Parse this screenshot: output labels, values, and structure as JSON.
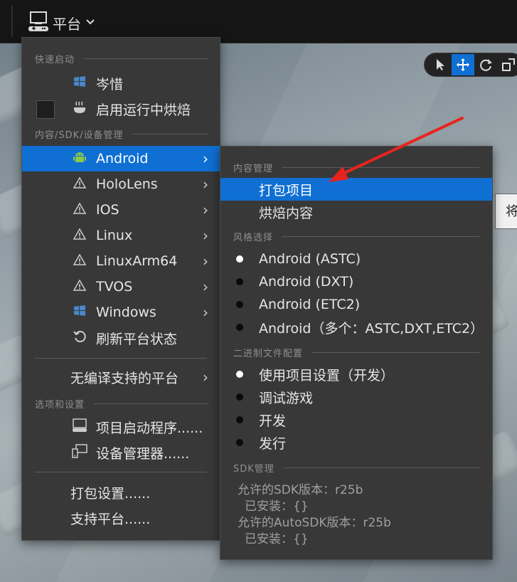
{
  "toolbar": {
    "platforms_label": "平台",
    "icons": {
      "platforms": "gamepad-monitor-icon",
      "dropdown": "chevron-down-icon"
    }
  },
  "gizmo": {
    "buttons": [
      "select-arrow-icon",
      "move-icon",
      "rotate-icon",
      "scale-icon"
    ],
    "active": "move-icon"
  },
  "side_button": {
    "label": "将"
  },
  "menu": {
    "sections": {
      "quick_launch": "快速启动",
      "content_sdk": "内容/SDK/设备管理",
      "options": "选项和设置"
    },
    "items": {
      "cenxi": "岑惜",
      "cook_on_fly": "启用运行中烘焙",
      "android": "Android",
      "hololens": "HoloLens",
      "ios": "IOS",
      "linux": "Linux",
      "linuxarm64": "LinuxArm64",
      "tvos": "TVOS",
      "windows": "Windows",
      "refresh": "刷新平台状态",
      "no_compile": "无编译支持的平台",
      "project_launcher": "项目启动程序......",
      "device_manager": "设备管理器......",
      "packaging_settings": "打包设置......",
      "supported_platforms": "支持平台......"
    },
    "selected": "Android"
  },
  "submenu": {
    "sections": {
      "content": "内容管理",
      "flavor": "风格选择",
      "binary": "二进制文件配置",
      "sdk": "SDK管理"
    },
    "content_items": [
      "打包项目",
      "烘焙内容"
    ],
    "flavors": [
      {
        "label": "Android (ASTC)",
        "selected": true
      },
      {
        "label": "Android (DXT)",
        "selected": false
      },
      {
        "label": "Android (ETC2)",
        "selected": false
      },
      {
        "label": "Android（多个：ASTC,DXT,ETC2）",
        "selected": false
      }
    ],
    "binary_configs": [
      {
        "label": "使用项目设置（开发）",
        "selected": true
      },
      {
        "label": "调试游戏",
        "selected": false
      },
      {
        "label": "开发",
        "selected": false
      },
      {
        "label": "发行",
        "selected": false
      }
    ],
    "sdk": {
      "allowed_sdk": "允许的SDK版本：r25b",
      "installed_sdk": "已安装：{}",
      "allowed_autosdk": "允许的AutoSDK版本：r25b",
      "installed_autosdk": "已安装：{}"
    },
    "highlighted": "打包项目"
  },
  "colors": {
    "accent": "#0f6fd3",
    "menu_bg": "#383838",
    "annotation": "#e8231d"
  }
}
